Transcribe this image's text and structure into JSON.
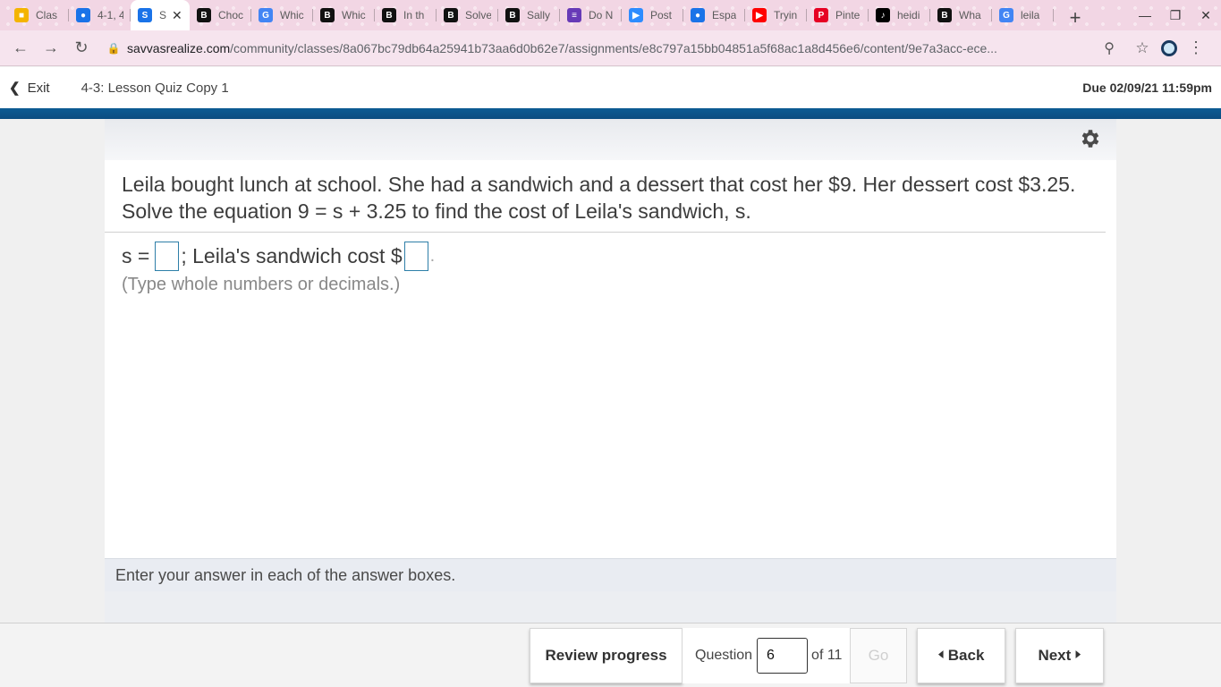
{
  "browser": {
    "tabs": [
      {
        "title": "Clas",
        "favicon": "classroom-icon",
        "color": "#f4b400"
      },
      {
        "title": "4-1, 4",
        "favicon": "contacts-icon",
        "color": "#1a73e8"
      },
      {
        "title": "S",
        "favicon": "savvas-icon",
        "color": "#1a73e8",
        "active": true
      },
      {
        "title": "Choc",
        "favicon": "brainly-icon",
        "color": "#111111"
      },
      {
        "title": "Whic",
        "favicon": "google-icon",
        "color": "#4285f4"
      },
      {
        "title": "Whic",
        "favicon": "brainly-icon",
        "color": "#111111"
      },
      {
        "title": "In th",
        "favicon": "brainly-icon",
        "color": "#111111"
      },
      {
        "title": "Solve",
        "favicon": "brainly-icon",
        "color": "#111111"
      },
      {
        "title": "Sally",
        "favicon": "brainly-icon",
        "color": "#111111"
      },
      {
        "title": "Do N",
        "favicon": "list-icon",
        "color": "#673ab7"
      },
      {
        "title": "Post",
        "favicon": "zoom-icon",
        "color": "#2d8cff"
      },
      {
        "title": "Espa",
        "favicon": "contacts-icon",
        "color": "#1a73e8"
      },
      {
        "title": "Tryin",
        "favicon": "youtube-icon",
        "color": "#ff0000"
      },
      {
        "title": "Pinte",
        "favicon": "pinterest-icon",
        "color": "#e60023"
      },
      {
        "title": "heidi",
        "favicon": "tiktok-icon",
        "color": "#000000"
      },
      {
        "title": "Wha",
        "favicon": "brainly-icon",
        "color": "#111111"
      },
      {
        "title": "leila",
        "favicon": "google-icon",
        "color": "#4285f4"
      }
    ],
    "url_host": "savvasrealize.com",
    "url_path": "/community/classes/8a067bc79db64a25941b73aa6d0b62e7/assignments/e8c797a15bb04851a5f68ac1a8d456e6/content/9e7a3acc-ece..."
  },
  "header": {
    "exit_label": "Exit",
    "quiz_title": "4-3: Lesson Quiz Copy 1",
    "due": "Due 02/09/21 11:59pm"
  },
  "question": {
    "text": "Leila bought lunch at school. She had a sandwich and a dessert that cost her $9. Her dessert cost $3.25. Solve the equation 9 = s + 3.25 to find the cost of Leila's sandwich, s.",
    "answer_prefix": "s =",
    "answer_middle": "; Leila's sandwich cost $",
    "answer_suffix": ".",
    "hint": "(Type whole numbers or decimals.)",
    "instruction": "Enter your answer in each of the answer boxes."
  },
  "footer": {
    "review_label": "Review progress",
    "question_label": "Question",
    "question_number": "6",
    "of_label": "of 11",
    "go_label": "Go",
    "back_label": "Back",
    "next_label": "Next"
  },
  "colors": {
    "brand_bar": "#0b4c80",
    "answer_box_border": "#2e7fa8"
  }
}
